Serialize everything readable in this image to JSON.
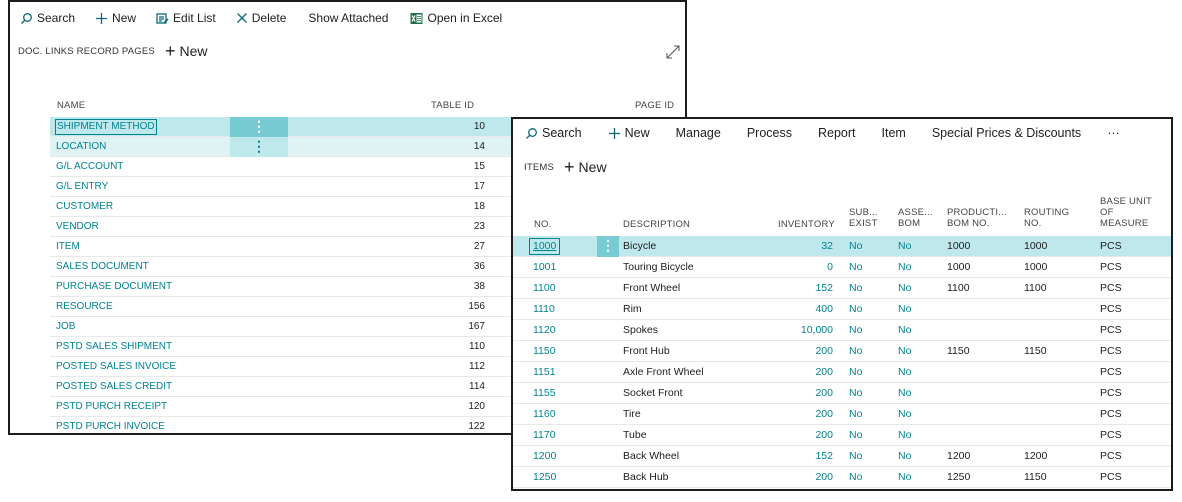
{
  "win1": {
    "toolbar": [
      {
        "label": "Search",
        "icon": "search-icon",
        "name": "search-button"
      },
      {
        "label": "New",
        "icon": "plus-icon",
        "name": "new-button"
      },
      {
        "label": "Edit List",
        "icon": "edit-list-icon",
        "name": "edit-list-button"
      },
      {
        "label": "Delete",
        "icon": "close-icon",
        "name": "delete-button"
      },
      {
        "label": "Show Attached",
        "icon": "",
        "name": "show-attached-button"
      },
      {
        "label": "Open in Excel",
        "icon": "excel-icon",
        "name": "open-in-excel-button"
      }
    ],
    "caption": "DOC. LINKS RECORD PAGES",
    "new_label": "New",
    "headers": {
      "name": "NAME",
      "table_id": "TABLE ID",
      "page_id": "PAGE ID"
    },
    "rows": [
      {
        "name": "SHIPMENT METHOD",
        "table_id": "10"
      },
      {
        "name": "LOCATION",
        "table_id": "14"
      },
      {
        "name": "G/L ACCOUNT",
        "table_id": "15"
      },
      {
        "name": "G/L ENTRY",
        "table_id": "17"
      },
      {
        "name": "CUSTOMER",
        "table_id": "18"
      },
      {
        "name": "VENDOR",
        "table_id": "23"
      },
      {
        "name": "ITEM",
        "table_id": "27"
      },
      {
        "name": "SALES DOCUMENT",
        "table_id": "36"
      },
      {
        "name": "PURCHASE DOCUMENT",
        "table_id": "38"
      },
      {
        "name": "RESOURCE",
        "table_id": "156"
      },
      {
        "name": "JOB",
        "table_id": "167"
      },
      {
        "name": "PSTD SALES SHIPMENT",
        "table_id": "110"
      },
      {
        "name": "POSTED SALES INVOICE",
        "table_id": "112"
      },
      {
        "name": "POSTED SALES CREDIT",
        "table_id": "114"
      },
      {
        "name": "PSTD PURCH RECEIPT",
        "table_id": "120"
      },
      {
        "name": "PSTD PURCH INVOICE",
        "table_id": "122"
      }
    ]
  },
  "win2": {
    "toolbar": [
      {
        "label": "Search",
        "icon": "search-icon",
        "name": "search-button"
      },
      {
        "label": "New",
        "icon": "plus-icon",
        "name": "new-button"
      },
      {
        "label": "Manage",
        "icon": "",
        "name": "manage-button"
      },
      {
        "label": "Process",
        "icon": "",
        "name": "process-button"
      },
      {
        "label": "Report",
        "icon": "",
        "name": "report-button"
      },
      {
        "label": "Item",
        "icon": "",
        "name": "item-button"
      },
      {
        "label": "Special Prices & Discounts",
        "icon": "",
        "name": "special-prices-button"
      },
      {
        "label": "···",
        "icon": "",
        "name": "more-actions-button"
      }
    ],
    "caption": "ITEMS",
    "new_label": "New",
    "headers": {
      "no": "NO.",
      "description": "DESCRIPTION",
      "inventory": "INVENTORY",
      "sub_exist": [
        "SUB...",
        "EXIST"
      ],
      "assembly_bom": [
        "ASSE...",
        "BOM"
      ],
      "production_bom": [
        "PRODUCTI...",
        "BOM NO."
      ],
      "routing": [
        "ROUTING",
        "NO."
      ],
      "base_unit": [
        "BASE UNIT",
        "OF",
        "MEASURE"
      ]
    },
    "rows": [
      {
        "no": "1000",
        "description": "Bicycle",
        "inventory": "32",
        "sub": "No",
        "asm": "No",
        "prod_bom": "1000",
        "routing": "1000",
        "uom": "PCS"
      },
      {
        "no": "1001",
        "description": "Touring Bicycle",
        "inventory": "0",
        "sub": "No",
        "asm": "No",
        "prod_bom": "1000",
        "routing": "1000",
        "uom": "PCS"
      },
      {
        "no": "1100",
        "description": "Front Wheel",
        "inventory": "152",
        "sub": "No",
        "asm": "No",
        "prod_bom": "1100",
        "routing": "1100",
        "uom": "PCS"
      },
      {
        "no": "1110",
        "description": "Rim",
        "inventory": "400",
        "sub": "No",
        "asm": "No",
        "prod_bom": "",
        "routing": "",
        "uom": "PCS"
      },
      {
        "no": "1120",
        "description": "Spokes",
        "inventory": "10,000",
        "sub": "No",
        "asm": "No",
        "prod_bom": "",
        "routing": "",
        "uom": "PCS"
      },
      {
        "no": "1150",
        "description": "Front Hub",
        "inventory": "200",
        "sub": "No",
        "asm": "No",
        "prod_bom": "1150",
        "routing": "1150",
        "uom": "PCS"
      },
      {
        "no": "1151",
        "description": "Axle Front Wheel",
        "inventory": "200",
        "sub": "No",
        "asm": "No",
        "prod_bom": "",
        "routing": "",
        "uom": "PCS"
      },
      {
        "no": "1155",
        "description": "Socket Front",
        "inventory": "200",
        "sub": "No",
        "asm": "No",
        "prod_bom": "",
        "routing": "",
        "uom": "PCS"
      },
      {
        "no": "1160",
        "description": "Tire",
        "inventory": "200",
        "sub": "No",
        "asm": "No",
        "prod_bom": "",
        "routing": "",
        "uom": "PCS"
      },
      {
        "no": "1170",
        "description": "Tube",
        "inventory": "200",
        "sub": "No",
        "asm": "No",
        "prod_bom": "",
        "routing": "",
        "uom": "PCS"
      },
      {
        "no": "1200",
        "description": "Back Wheel",
        "inventory": "152",
        "sub": "No",
        "asm": "No",
        "prod_bom": "1200",
        "routing": "1200",
        "uom": "PCS"
      },
      {
        "no": "1250",
        "description": "Back Hub",
        "inventory": "200",
        "sub": "No",
        "asm": "No",
        "prod_bom": "1250",
        "routing": "1150",
        "uom": "PCS"
      }
    ]
  }
}
